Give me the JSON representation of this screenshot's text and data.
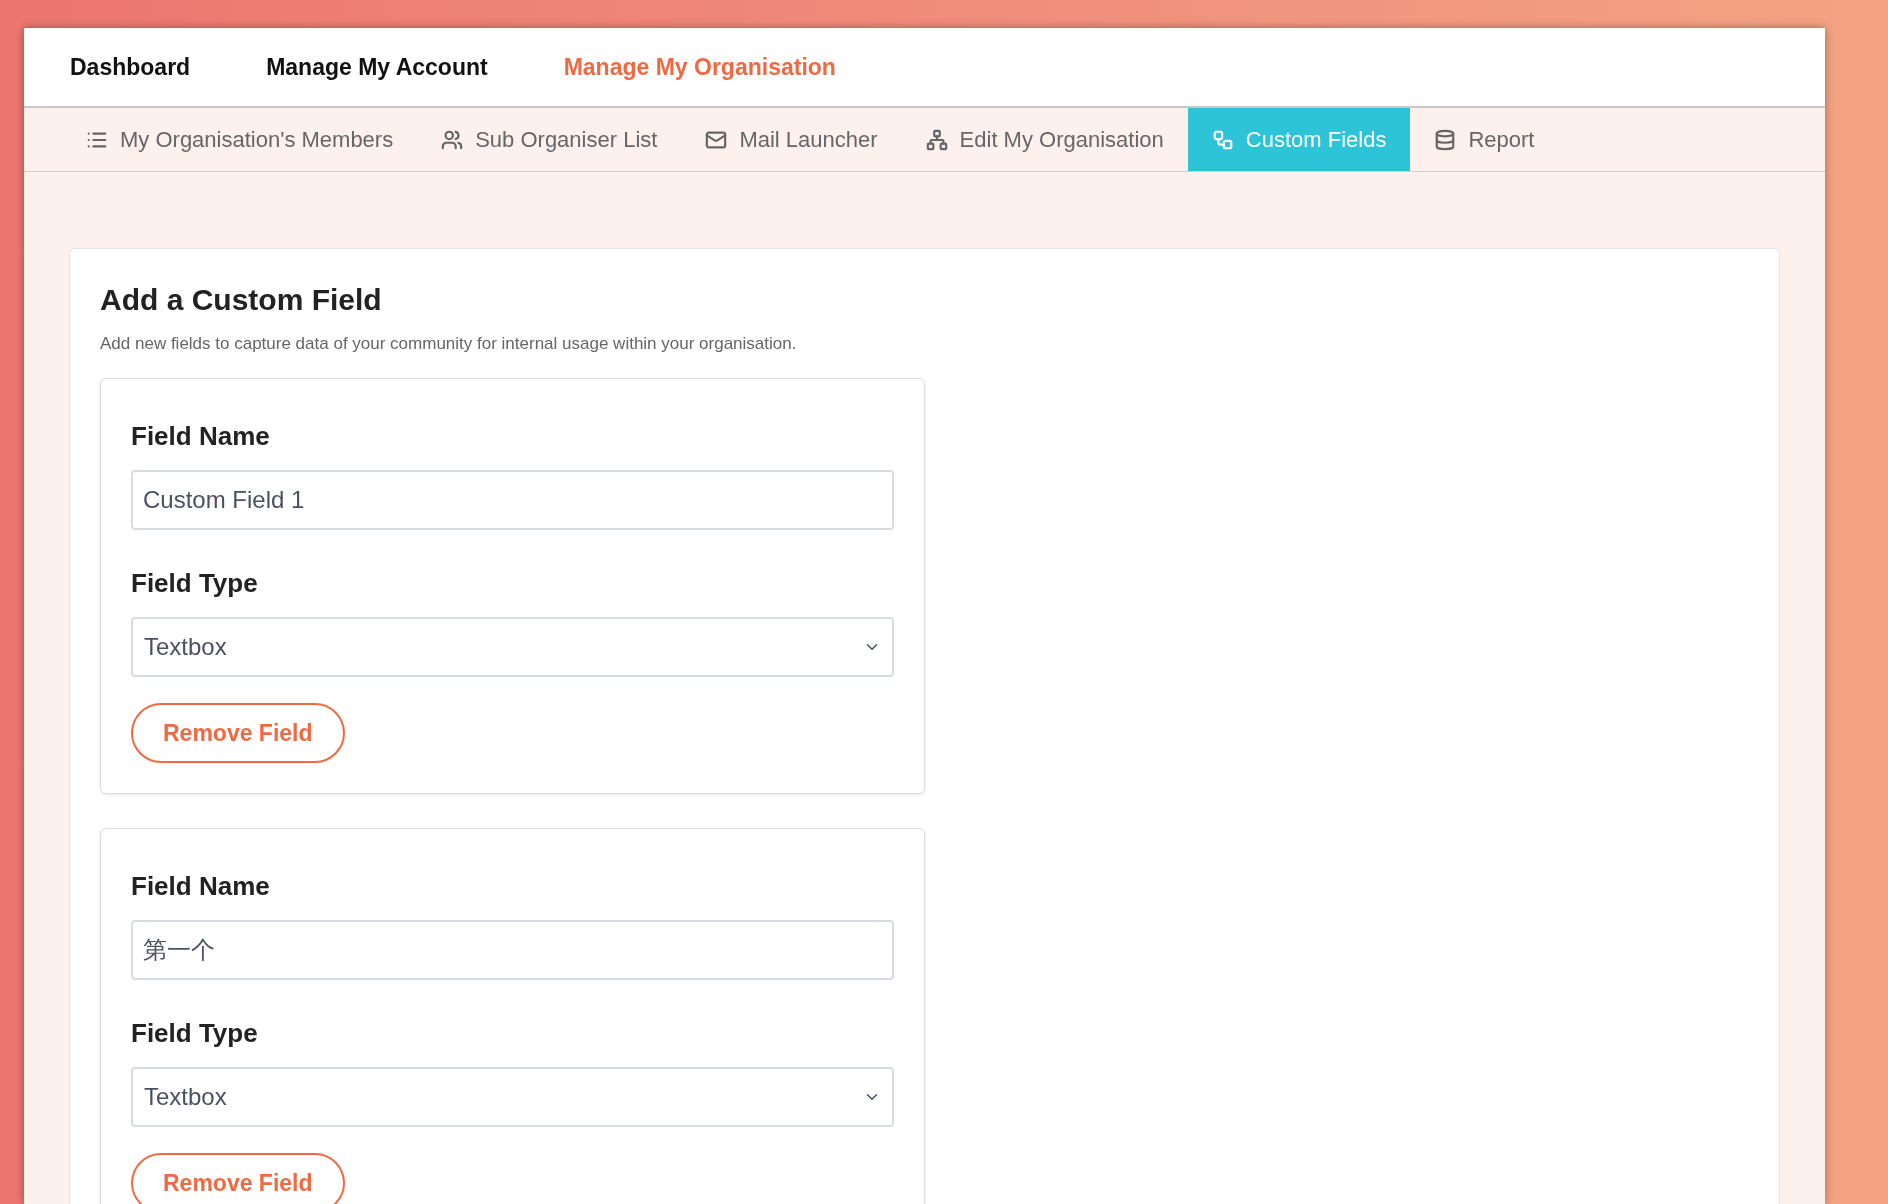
{
  "top_nav": [
    {
      "label": "Dashboard",
      "selected": false
    },
    {
      "label": "Manage My Account",
      "selected": false
    },
    {
      "label": "Manage My Organisation",
      "selected": true
    }
  ],
  "sub_tabs": [
    {
      "label": "My Organisation's Members",
      "selected": false
    },
    {
      "label": "Sub Organiser List",
      "selected": false
    },
    {
      "label": "Mail Launcher",
      "selected": false
    },
    {
      "label": "Edit My Organisation",
      "selected": false
    },
    {
      "label": "Custom Fields",
      "selected": true
    },
    {
      "label": "Report",
      "selected": false
    }
  ],
  "card": {
    "title": "Add a Custom Field",
    "description": "Add new fields to capture data of your community for internal usage within your organisation.",
    "fields": [
      {
        "name_label": "Field Name",
        "name_value": "Custom Field 1",
        "type_label": "Field Type",
        "type_value": "Textbox",
        "remove_label": "Remove Field"
      },
      {
        "name_label": "Field Name",
        "name_value": "第一个",
        "type_label": "Field Type",
        "type_value": "Textbox",
        "remove_label": "Remove Field"
      }
    ]
  }
}
